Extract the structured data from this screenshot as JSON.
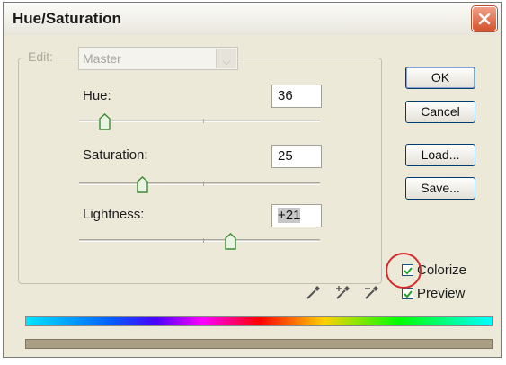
{
  "window": {
    "title": "Hue/Saturation"
  },
  "edit": {
    "label": "Edit:",
    "value": "Master"
  },
  "sliders": {
    "hue": {
      "label": "Hue:",
      "value": "36"
    },
    "saturation": {
      "label": "Saturation:",
      "value": "25"
    },
    "lightness": {
      "label": "Lightness:",
      "value": "+21"
    }
  },
  "buttons": {
    "ok": "OK",
    "cancel": "Cancel",
    "load": "Load...",
    "save": "Save..."
  },
  "checkboxes": {
    "colorize": {
      "label": "Colorize",
      "checked": true
    },
    "preview": {
      "label": "Preview",
      "checked": true
    }
  },
  "icons": [
    "close-icon",
    "eyedropper-icon",
    "eyedropper-plus-icon",
    "eyedropper-minus-icon",
    "checkmark-icon"
  ],
  "colors": {
    "highlight_ring": "#d62a2a",
    "result_bar": "#a99d83"
  }
}
